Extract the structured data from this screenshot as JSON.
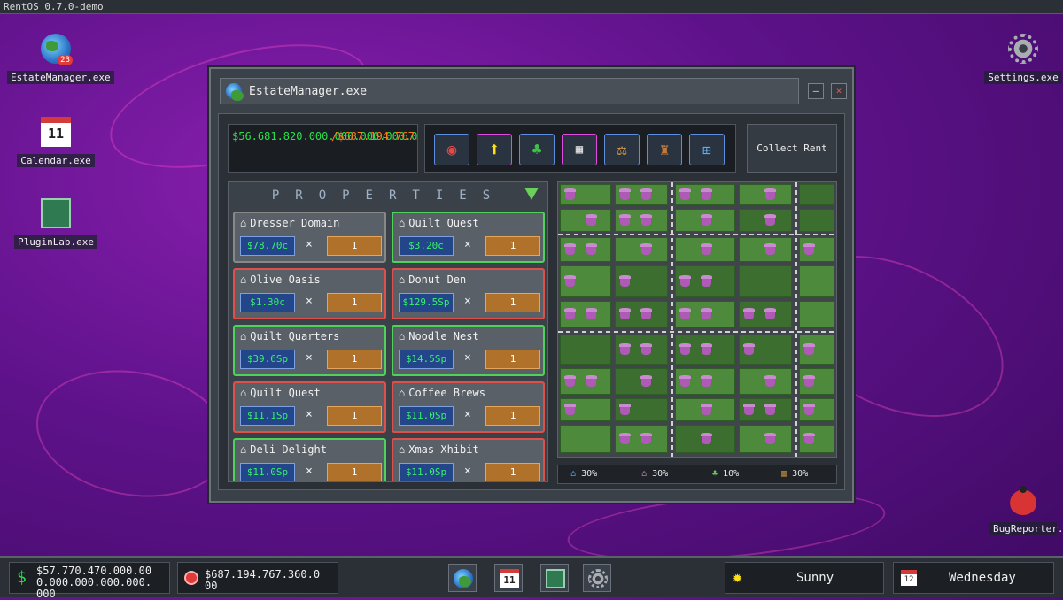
{
  "os": {
    "title": "RentOS 0.7.0-demo"
  },
  "desktop": {
    "icons": [
      {
        "label": "EstateManager.exe",
        "badge": "23",
        "icon": "globe-icon"
      },
      {
        "label": "Calendar.exe",
        "icon": "calendar-icon",
        "day": "11"
      },
      {
        "label": "PluginLab.exe",
        "icon": "plugin-icon"
      },
      {
        "label": "Settings.exe",
        "icon": "gear-icon"
      },
      {
        "label": "BugReporter.exe",
        "icon": "bug-icon"
      }
    ]
  },
  "window": {
    "title": "EstateManager.exe",
    "minimize": "–",
    "close": "×",
    "balance": "$56.681.820.000.000.000.000.000.000.000.000",
    "debt": "/$687.194.767.360.000",
    "collect_rent": "Collect Rent",
    "tools": [
      {
        "icon": "mouth-icon"
      },
      {
        "icon": "upgrade-arrow-icon",
        "active": true
      },
      {
        "icon": "clover-icon"
      },
      {
        "icon": "stock-chart-icon"
      },
      {
        "icon": "scales-icon"
      },
      {
        "icon": "auction-icon"
      },
      {
        "icon": "calculator-icon"
      }
    ],
    "properties_title": "PROPERTIES",
    "properties": [
      {
        "name": "Dresser Domain",
        "price": "$78.70c",
        "qty": "1",
        "status": "neutral"
      },
      {
        "name": "Quilt Quest",
        "price": "$3.20c",
        "qty": "1",
        "status": "green"
      },
      {
        "name": "Olive Oasis",
        "price": "$1.30c",
        "qty": "1",
        "status": "red"
      },
      {
        "name": "Donut Den",
        "price": "$129.5Sp",
        "qty": "1",
        "status": "red"
      },
      {
        "name": "Quilt Quarters",
        "price": "$39.6Sp",
        "qty": "1",
        "status": "green"
      },
      {
        "name": "Noodle Nest",
        "price": "$14.5Sp",
        "qty": "1",
        "status": "green"
      },
      {
        "name": "Quilt Quest",
        "price": "$11.1Sp",
        "qty": "1",
        "status": "red"
      },
      {
        "name": "Coffee Brews",
        "price": "$11.0Sp",
        "qty": "1",
        "status": "red"
      },
      {
        "name": "Deli Delight",
        "price": "$11.0Sp",
        "qty": "1",
        "status": "green"
      },
      {
        "name": "Xmas Xhibit",
        "price": "$11.0Sp",
        "qty": "1",
        "status": "red"
      }
    ],
    "multiply_sign": "×",
    "legend": [
      {
        "icon": "house-icon",
        "value": "30%",
        "color": "#5ab0f0"
      },
      {
        "icon": "cupcake-icon",
        "value": "30%",
        "color": "#c98ad0"
      },
      {
        "icon": "plant-icon",
        "value": "10%",
        "color": "#6ad05a"
      },
      {
        "icon": "factory-icon",
        "value": "30%",
        "color": "#e0a040"
      }
    ]
  },
  "taskbar": {
    "balance": "$57.770.470.000.000.000.000.000.000.000.000.000",
    "balance_line1": "$57.770.470.000.00",
    "balance_line2": "0.000.000.000.000.",
    "balance_line3": "000",
    "debt_line1": "$687.194.767.360.0",
    "debt_line2": "00",
    "weather": "Sunny",
    "day": "Wednesday",
    "calendar_day": "11",
    "calendar_day_small": "12"
  }
}
